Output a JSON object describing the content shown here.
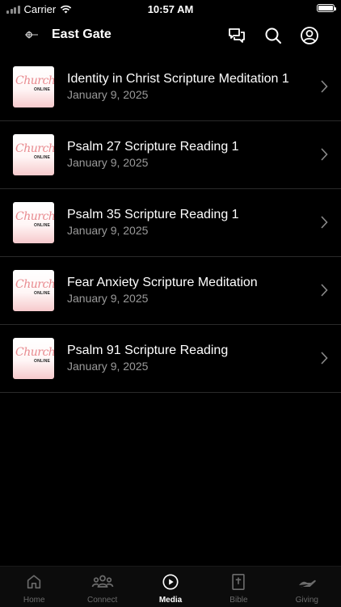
{
  "status_bar": {
    "carrier": "Carrier",
    "time": "10:57 AM",
    "battery_level": 1.0
  },
  "header": {
    "title": "East Gate",
    "logo_icon": "church-logo-icon",
    "icons": [
      "chat-icon",
      "search-icon",
      "account-icon"
    ]
  },
  "items": [
    {
      "title": "Identity in Christ Scripture Meditation 1",
      "date": "January 9, 2025"
    },
    {
      "title": "Psalm 27 Scripture Reading 1",
      "date": "January 9, 2025"
    },
    {
      "title": "Psalm 35 Scripture Reading 1",
      "date": "January 9, 2025"
    },
    {
      "title": "Fear Anxiety Scripture Meditation",
      "date": "January 9, 2025"
    },
    {
      "title": "Psalm 91 Scripture Reading",
      "date": "January 9, 2025"
    }
  ],
  "thumbnail": {
    "script_text": "Church",
    "sub_text": "ONLINE",
    "accent": "#e88a8f"
  },
  "tabs": [
    {
      "label": "Home",
      "icon": "home-icon",
      "active": false
    },
    {
      "label": "Connect",
      "icon": "people-icon",
      "active": false
    },
    {
      "label": "Media",
      "icon": "play-icon",
      "active": true
    },
    {
      "label": "Bible",
      "icon": "bible-icon",
      "active": false
    },
    {
      "label": "Giving",
      "icon": "giving-hand-icon",
      "active": false
    }
  ],
  "colors": {
    "background": "#000000",
    "active_tab": "#ffffff",
    "inactive_tab": "#6b6b6b",
    "secondary_text": "#9a9a9a"
  }
}
